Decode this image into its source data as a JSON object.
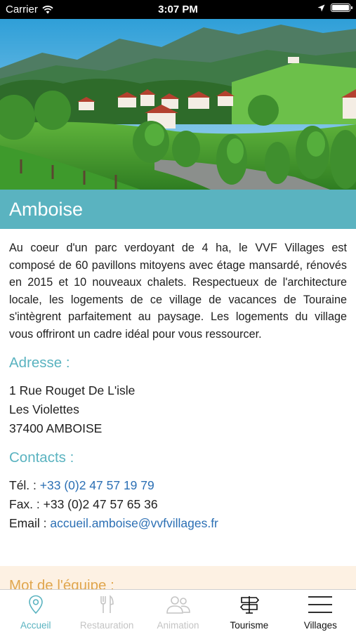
{
  "status_bar": {
    "carrier": "Carrier",
    "time": "3:07 PM"
  },
  "village": {
    "name": "Amboise",
    "description": "Au coeur d'un parc verdoyant de 4 ha, le VVF Villages est composé de 60 pavillons mitoyens avec étage mansardé, rénovés en 2015 et 10 nouveaux chalets. Respectueux de l'architecture locale, les logements de ce village de vacances de Touraine s'intègrent parfaitement au paysage. Les logements du village vous offriront un cadre idéal pour vous ressourcer."
  },
  "address": {
    "title": "Adresse :",
    "line1": "1 Rue Rouget De L'isle",
    "line2": "Les Violettes",
    "line3": "37400 AMBOISE"
  },
  "contacts": {
    "title": "Contacts :",
    "tel_label": "Tél. : ",
    "tel_value": "+33 (0)2 47 57 19 79",
    "fax_label": "Fax. : ",
    "fax_value": "+33 (0)2 47 57 65 36",
    "email_label": "Email : ",
    "email_value": "accueil.amboise@vvfvillages.fr"
  },
  "equipe": {
    "title": "Mot de l'équipe :"
  },
  "tabs": [
    {
      "label": "Accueil",
      "icon": "location-pin-icon",
      "state": "active"
    },
    {
      "label": "Restauration",
      "icon": "fork-knife-icon",
      "state": "disabled"
    },
    {
      "label": "Animation",
      "icon": "people-icon",
      "state": "disabled"
    },
    {
      "label": "Tourisme",
      "icon": "signpost-icon",
      "state": "normal"
    },
    {
      "label": "Villages",
      "icon": "menu-icon",
      "state": "normal"
    }
  ],
  "colors": {
    "accent": "#5ab3c0",
    "link": "#2b6fb4",
    "equipe_bg": "#fdf1e3",
    "equipe_title": "#e0a64e",
    "disabled": "#c4c4c4"
  }
}
